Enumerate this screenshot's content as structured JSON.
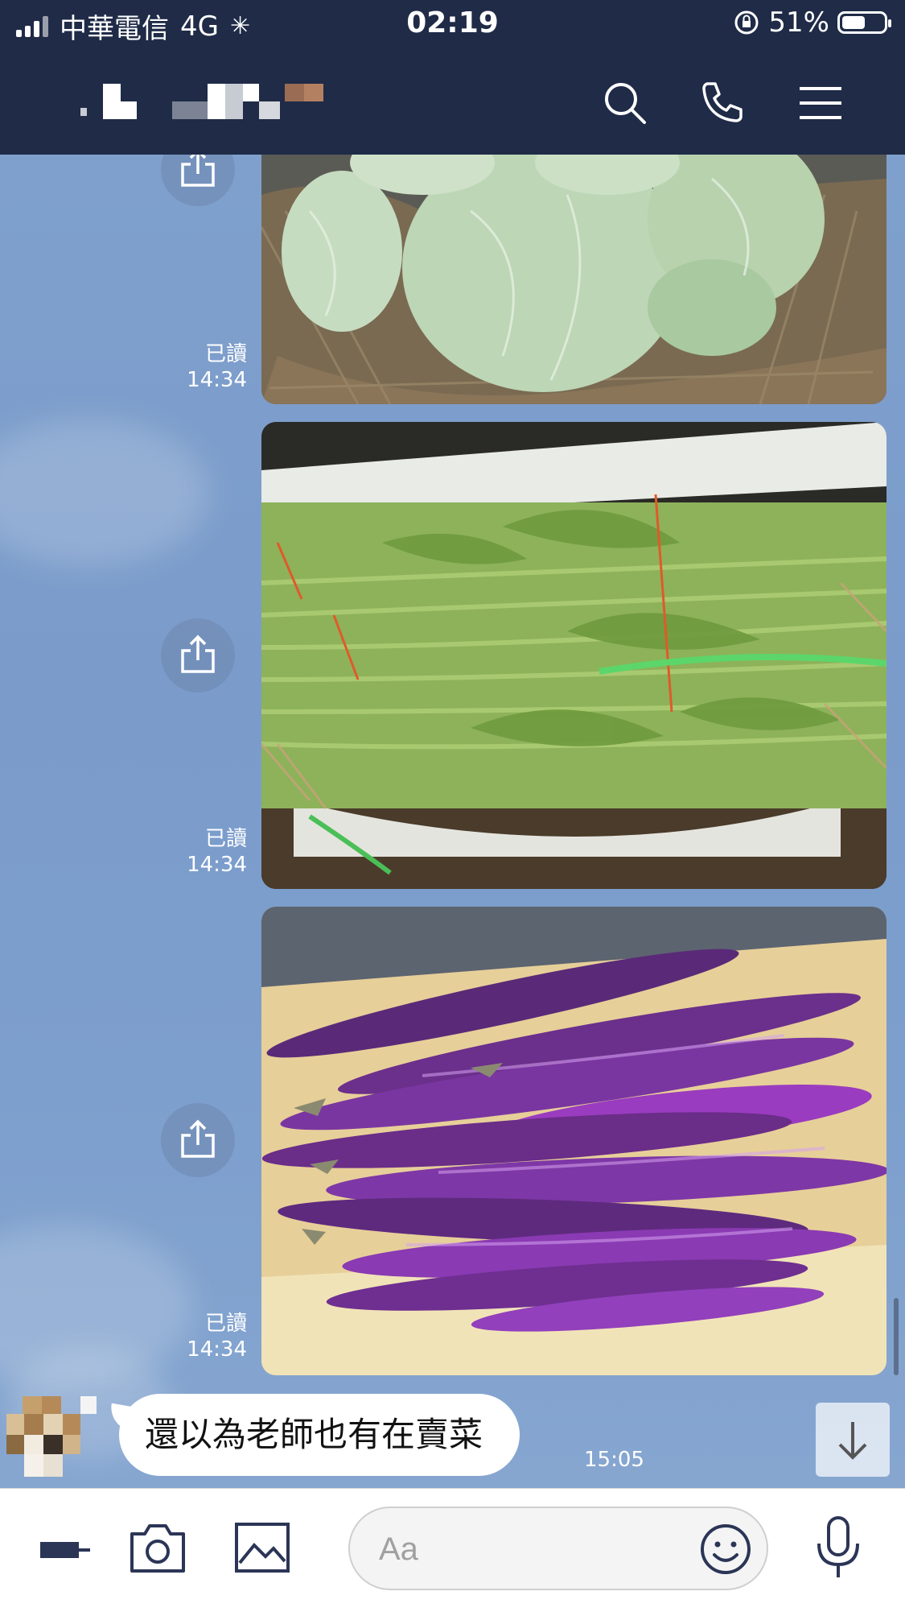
{
  "status_bar": {
    "carrier": "中華電信",
    "network": "4G",
    "time": "02:19",
    "battery_percent": "51%"
  },
  "header": {
    "contact_name_hidden": true
  },
  "messages": [
    {
      "type": "image",
      "subject": "cabbages",
      "read_label": "已讀",
      "time": "14:34"
    },
    {
      "type": "image",
      "subject": "water spinach",
      "read_label": "已讀",
      "time": "14:34"
    },
    {
      "type": "image",
      "subject": "eggplants",
      "read_label": "已讀",
      "time": "14:34"
    },
    {
      "type": "text",
      "text": "還以為老師也有在賣菜",
      "time": "15:05"
    }
  ],
  "input": {
    "placeholder": "Aa"
  },
  "colors": {
    "header_bg": "#1f2b47",
    "chat_bg": "#7d9fcc",
    "bubble_bg": "#ffffff"
  },
  "icons": [
    "search-icon",
    "phone-icon",
    "menu-icon",
    "share-icon",
    "scroll-down-icon",
    "expand-icon",
    "camera-icon",
    "image-icon",
    "emoji-icon",
    "mic-icon"
  ]
}
